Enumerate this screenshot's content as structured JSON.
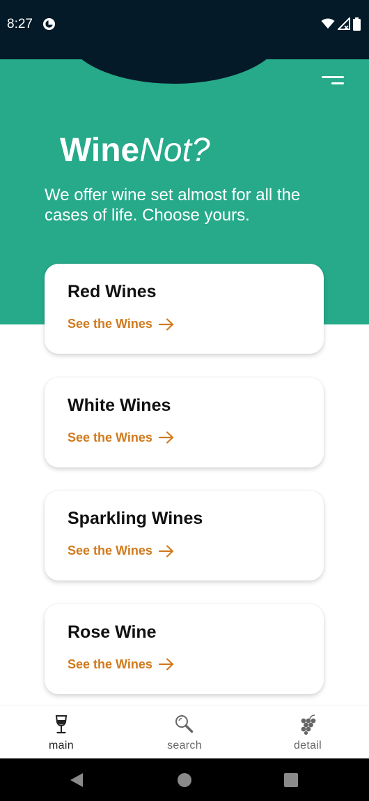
{
  "status_bar": {
    "time": "8:27",
    "app_icon": "notification-app-icon",
    "wifi_icon": "wifi-icon",
    "signal_icon": "signal-no-data-icon",
    "battery_icon": "battery-icon"
  },
  "header": {
    "menu_icon": "menu-icon",
    "brand_bold": "Wine",
    "brand_italic": "Not?",
    "tagline": "We offer wine set almost for all the cases of life. Choose yours."
  },
  "categories": [
    {
      "title": "Red Wines",
      "link": "See the Wines"
    },
    {
      "title": "White Wines",
      "link": "See the Wines"
    },
    {
      "title": "Sparkling Wines",
      "link": "See the Wines"
    },
    {
      "title": "Rose Wine",
      "link": "See the Wines"
    }
  ],
  "bottom_nav": {
    "items": [
      {
        "label": "main",
        "icon": "wine-glass-icon",
        "active": true
      },
      {
        "label": "search",
        "icon": "search-icon",
        "active": false
      },
      {
        "label": "detail",
        "icon": "grapes-icon",
        "active": false
      }
    ]
  },
  "system_nav": {
    "back": "back-icon",
    "home": "home-icon",
    "recents": "recents-icon"
  },
  "colors": {
    "accent_green": "#26aa8a",
    "dark_navy": "#041a28",
    "link_orange": "#d17a1c",
    "card_background": "#ffffff"
  }
}
